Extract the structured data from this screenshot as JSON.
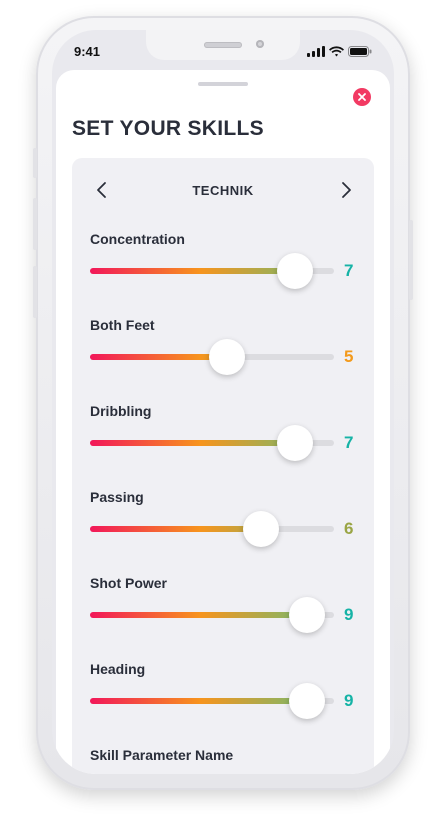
{
  "status_bar": {
    "time": "9:41"
  },
  "sheet": {
    "title": "SET YOUR SKILLS",
    "category": "TECHNIK",
    "skills": [
      {
        "name": "Concentration",
        "value": "7",
        "level": 0.84,
        "color": "#16b3a6"
      },
      {
        "name": "Both Feet",
        "value": "5",
        "level": 0.56,
        "color": "#f39a1c"
      },
      {
        "name": "Dribbling",
        "value": "7",
        "level": 0.84,
        "color": "#16b3a6"
      },
      {
        "name": "Passing",
        "value": "6",
        "level": 0.7,
        "color": "#9aa545"
      },
      {
        "name": "Shot Power",
        "value": "9",
        "level": 0.89,
        "color": "#16b3a6"
      },
      {
        "name": "Heading",
        "value": "9",
        "level": 0.89,
        "color": "#16b3a6"
      },
      {
        "name": "Skill Parameter Name",
        "value": "",
        "level": null,
        "color": ""
      }
    ],
    "accent_close": "#f23a63"
  },
  "icons": {
    "close": "close-icon",
    "prev": "chevron-left-icon",
    "next": "chevron-right-icon",
    "signal": "signal-icon",
    "wifi": "wifi-icon",
    "battery": "battery-icon"
  }
}
